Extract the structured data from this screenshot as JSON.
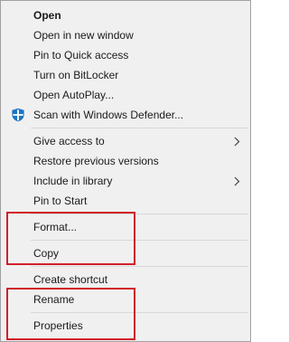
{
  "menu": {
    "items": [
      {
        "label": "Open"
      },
      {
        "label": "Open in new window"
      },
      {
        "label": "Pin to Quick access"
      },
      {
        "label": "Turn on BitLocker"
      },
      {
        "label": "Open AutoPlay..."
      },
      {
        "label": "Scan with Windows Defender...",
        "icon": "windows-defender-shield-icon"
      },
      {
        "label": "Give access to",
        "submenu": true
      },
      {
        "label": "Restore previous versions"
      },
      {
        "label": "Include in library",
        "submenu": true
      },
      {
        "label": "Pin to Start"
      },
      {
        "label": "Format..."
      },
      {
        "label": "Copy"
      },
      {
        "label": "Create shortcut"
      },
      {
        "label": "Rename"
      },
      {
        "label": "Properties"
      }
    ]
  },
  "colors": {
    "menu_background": "#f0f0f0",
    "separator": "#d7d7d7",
    "highlight_box": "#d0202a",
    "defender_blue": "#1c74c4"
  },
  "icons": {
    "submenu": "chevron-right-icon",
    "defender": "windows-defender-shield-icon"
  }
}
